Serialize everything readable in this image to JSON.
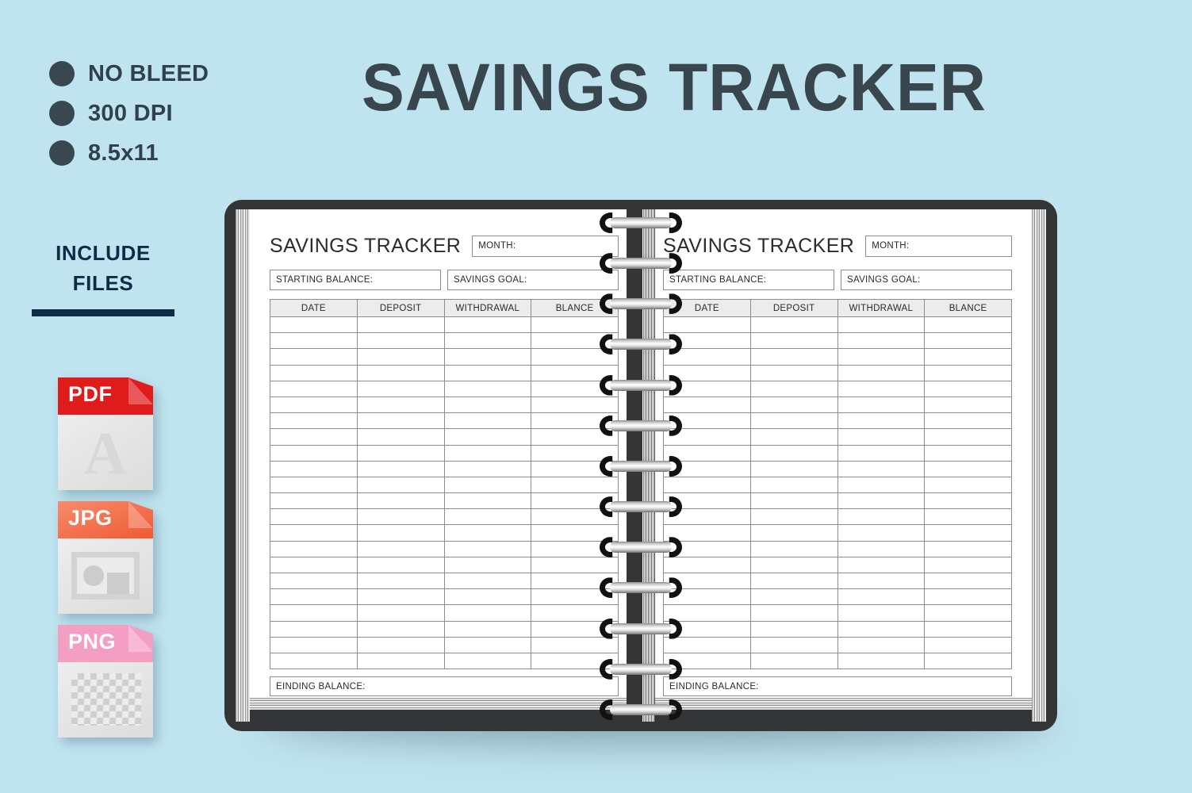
{
  "background_color": "#bfe4f0",
  "accent_dark": "#39464e",
  "navy": "#0e2a45",
  "specs": [
    {
      "label": "NO BLEED",
      "icon": "bullet-dot-icon"
    },
    {
      "label": "300 DPI",
      "icon": "bullet-dot-icon"
    },
    {
      "label": "8.5x11",
      "icon": "bullet-dot-icon"
    }
  ],
  "include_files": {
    "line1": "INCLUDE",
    "line2": "FILES",
    "formats": [
      {
        "label": "PDF",
        "color": "#e01b1b",
        "icon": "pdf-file-icon",
        "glyph": "A"
      },
      {
        "label": "JPG",
        "color": "#ef5a33",
        "icon": "jpg-file-icon"
      },
      {
        "label": "PNG",
        "color": "#f49ec4",
        "icon": "png-file-icon"
      }
    ]
  },
  "main_title": "SAVINGS TRACKER",
  "sheet": {
    "title": "SAVINGS TRACKER",
    "month_label": "MONTH:",
    "starting_balance_label": "STARTING BALANCE:",
    "savings_goal_label": "SAVINGS GOAL:",
    "columns": [
      "DATE",
      "DEPOSIT",
      "WITHDRAWAL",
      "BLANCE"
    ],
    "row_count": 22,
    "ending_balance_label": "EINDING BALANCE:"
  },
  "notebook": {
    "cover_color": "#333536",
    "spiral_ring_count": 13,
    "page_color": "#ffffff"
  }
}
